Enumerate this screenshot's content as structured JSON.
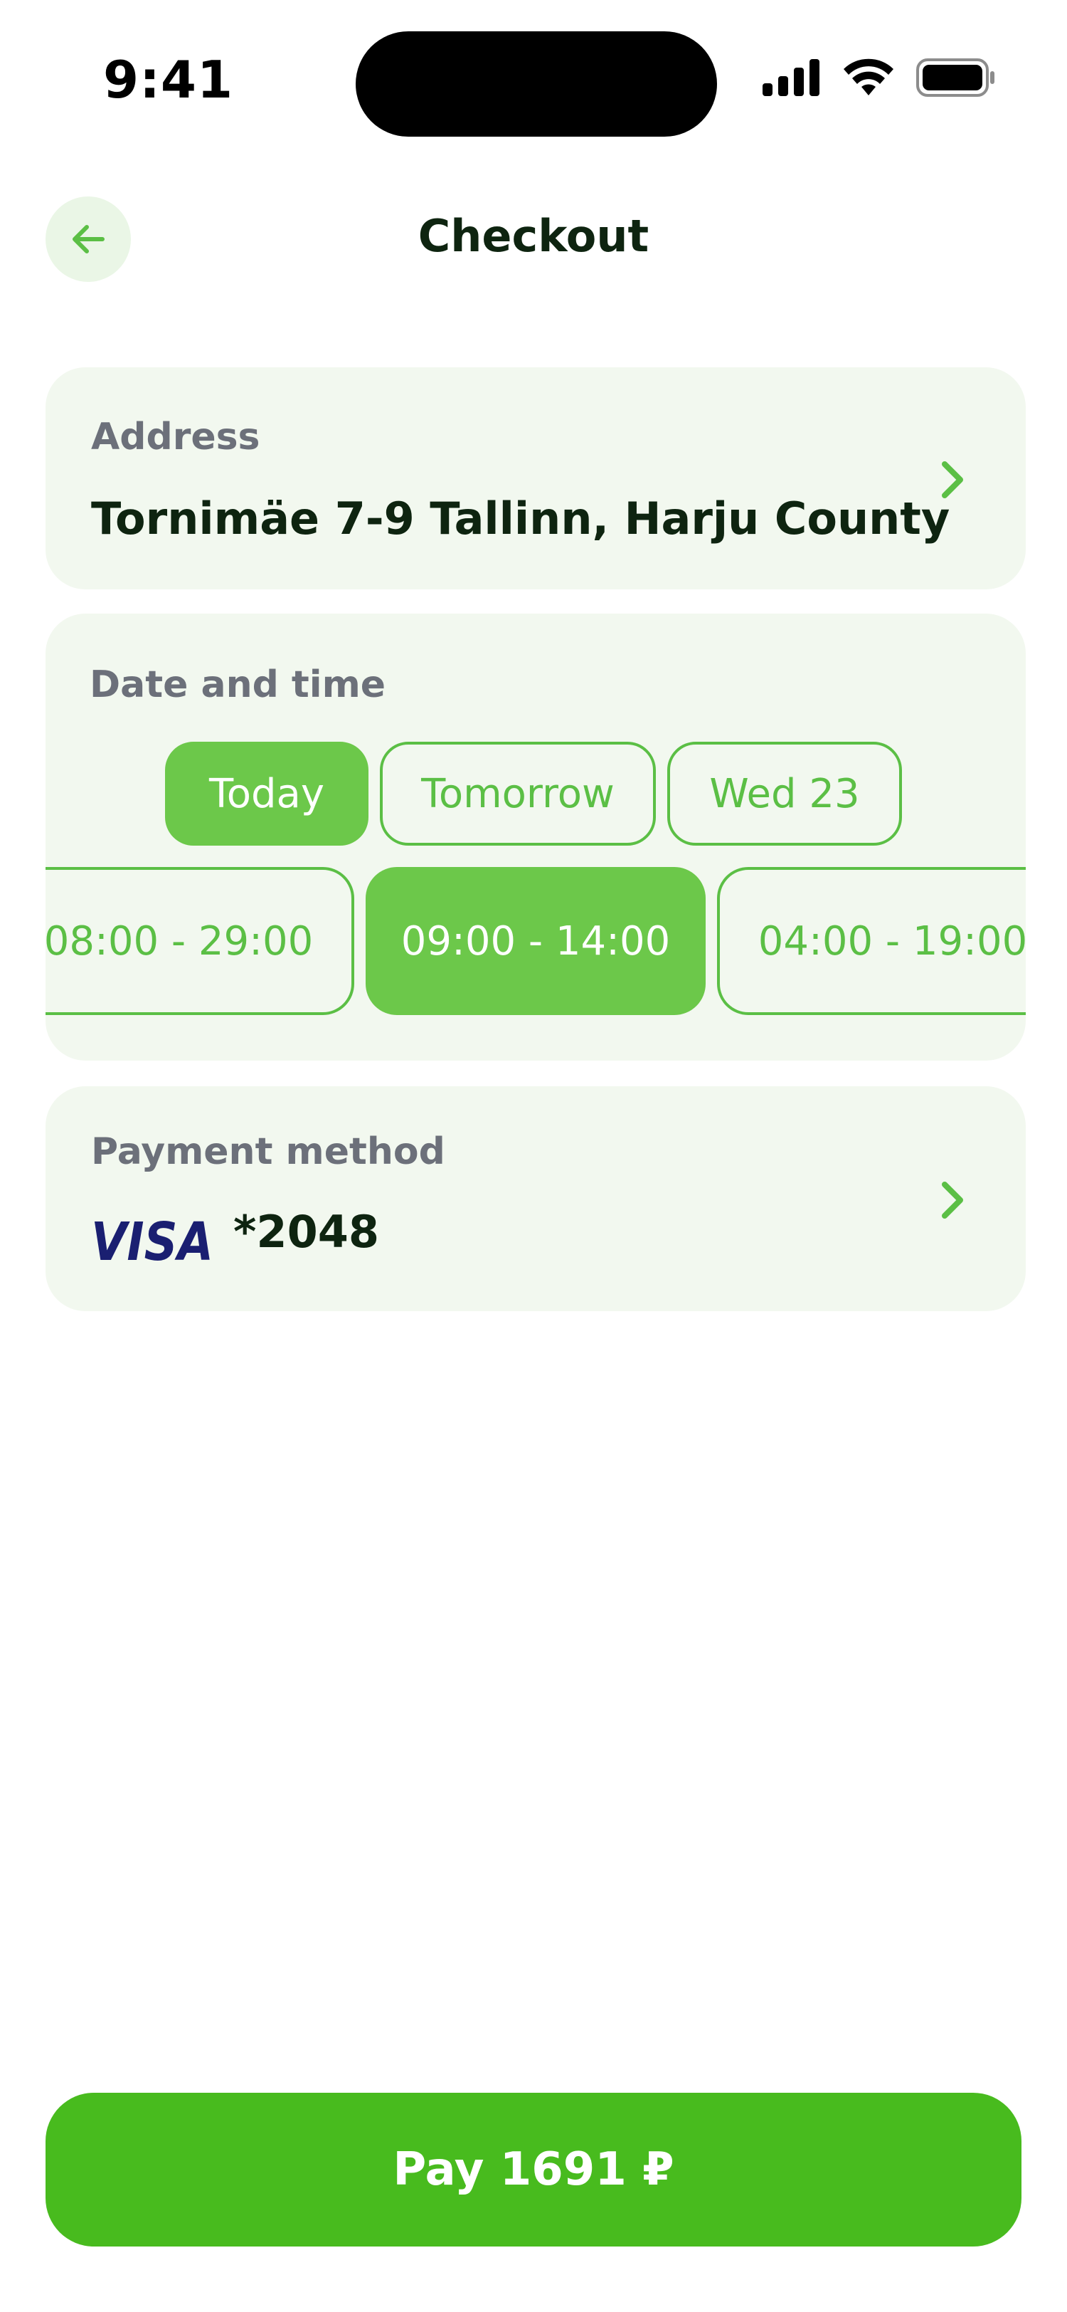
{
  "status_bar": {
    "time": "9:41",
    "icons": [
      "signal-icon",
      "wifi-icon",
      "battery-icon"
    ]
  },
  "header": {
    "title": "Checkout",
    "back_icon": "arrow-left-icon"
  },
  "address": {
    "label": "Address",
    "value": "Tornimäe 7-9 Tallinn, Harju County"
  },
  "datetime": {
    "label": "Date and time",
    "days": [
      {
        "label": "Today",
        "selected": true
      },
      {
        "label": "Tomorrow",
        "selected": false
      },
      {
        "label": "Wed 23",
        "selected": false
      }
    ],
    "slots": [
      {
        "label": "08:00 - 29:00",
        "selected": false
      },
      {
        "label": "09:00 - 14:00",
        "selected": true
      },
      {
        "label": "04:00 - 19:00",
        "selected": false
      }
    ]
  },
  "payment": {
    "label": "Payment method",
    "brand": "VISA",
    "card_masked": "*2048"
  },
  "pay_button": {
    "label": "Pay 1691 ₽"
  },
  "colors": {
    "accent": "#48bb1e",
    "chip_selected": "#6cc84a",
    "chip_outline": "#5bbf45",
    "card_bg": "#f2f8ef",
    "title_text": "#0e2410",
    "label_text": "#6c707a",
    "visa_blue": "#1a1f71"
  }
}
